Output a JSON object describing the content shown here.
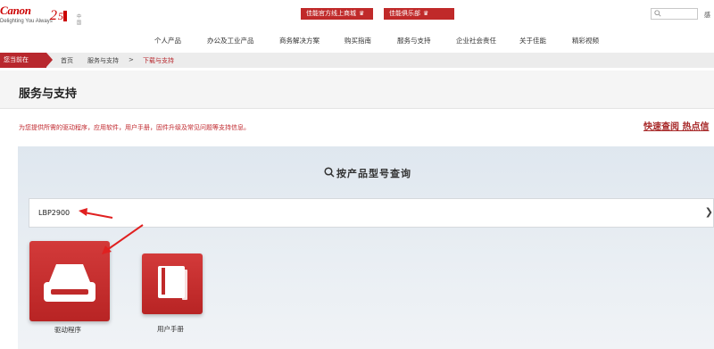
{
  "header": {
    "brand": "Canon",
    "tagline": "Delighting You Always",
    "region": "中国",
    "shop_button": "佳能官方线上商城",
    "club_button": "佳能俱乐部",
    "search_placeholder": "",
    "lang_hint": "感"
  },
  "nav": {
    "items": [
      "个人产品",
      "办公及工业产品",
      "商务解决方案",
      "购买指南",
      "服务与支持",
      "企业社会责任",
      "关于佳能",
      "精彩视频"
    ]
  },
  "breadcrumb": {
    "here": "您当前在",
    "home": "首页",
    "support": "服务与支持",
    "sep": ">",
    "active": "下载与支持"
  },
  "page": {
    "title": "服务与支持",
    "intro": "为您提供所需的驱动程序，应用软件，用户手册，固件升级及常见问题等支持信息。",
    "quick_link": "快速查阅 热点信"
  },
  "search_panel": {
    "title": "按产品型号查询",
    "model_value": "LBP2900",
    "chevron": "❯"
  },
  "tiles": {
    "driver_label": "驱动程序",
    "manual_label": "用户手册"
  },
  "colors": {
    "brand_red": "#cc0000",
    "accent_red": "#b8282e",
    "annotation_red": "#e02020"
  }
}
